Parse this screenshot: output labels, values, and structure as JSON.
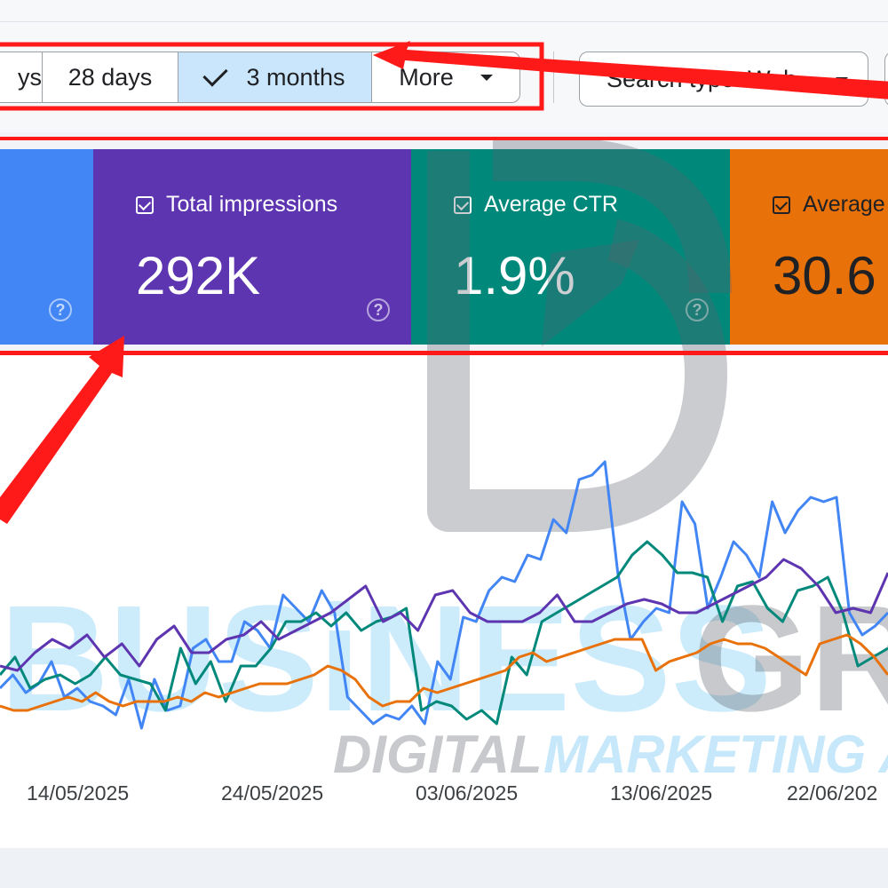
{
  "date_range": {
    "partial_label": "ys",
    "options": [
      {
        "label": "28 days"
      },
      {
        "label": "3 months",
        "selected": true
      },
      {
        "label": "More"
      }
    ]
  },
  "search_type": {
    "label": "Search type: Web"
  },
  "metrics": [
    {
      "label": "",
      "value": "",
      "color": "#4285f4"
    },
    {
      "label": "Total impressions",
      "value": "292K",
      "color": "#5e35b1"
    },
    {
      "label": "Average CTR",
      "value": "1.9%",
      "color": "#00897b"
    },
    {
      "label": "Average",
      "value": "30.6",
      "color": "#e8710a"
    }
  ],
  "watermark": {
    "word1": "BUSiNESS",
    "word2": "GRO",
    "tagline1": "DIGITAL",
    "tagline2": "MARKETING A"
  },
  "chart_data": {
    "type": "line",
    "x_tick_labels": [
      "14/05/2025",
      "24/05/2025",
      "03/06/2025",
      "13/06/2025",
      "22/06/202"
    ],
    "series": [
      {
        "color": "#4285f4",
        "values": [
          775,
          760,
          780,
          770,
          745,
          785,
          775,
          790,
          795,
          805,
          765,
          820,
          765,
          800,
          795,
          730,
          720,
          745,
          745,
          700,
          710,
          730,
          670,
          685,
          700,
          665,
          690,
          785,
          800,
          815,
          805,
          810,
          795,
          815,
          745,
          765,
          695,
          700,
          665,
          650,
          655,
          625,
          630,
          585,
          600,
          540,
          535,
          520,
          645,
          720,
          700,
          685,
          690,
          565,
          590,
          685,
          650,
          610,
          625,
          650,
          565,
          600,
          575,
          560,
          565,
          560,
          690,
          715,
          705,
          690
        ]
      },
      {
        "color": "#00897b",
        "values": [
          760,
          740,
          775,
          765,
          760,
          770,
          760,
          740,
          760,
          765,
          770,
          800,
          730,
          770,
          745,
          790,
          750,
          750,
          730,
          700,
          700,
          690,
          705,
          690,
          710,
          700,
          695,
          685,
          800,
          790,
          795,
          810,
          800,
          815,
          740,
          760,
          700,
          690,
          680,
          670,
          660,
          650,
          625,
          610,
          625,
          645,
          645,
          650,
          700,
          660,
          655,
          685,
          700,
          665,
          660,
          650,
          690,
          750,
          740,
          730
        ]
      },
      {
        "color": "#5e35b1",
        "values": [
          750,
          755,
          735,
          720,
          730,
          715,
          740,
          725,
          750,
          720,
          705,
          735,
          735,
          720,
          715,
          700,
          720,
          710,
          700,
          690,
          675,
          660,
          700,
          690,
          710,
          670,
          665,
          690,
          700,
          700,
          700,
          690,
          670,
          700,
          700,
          690,
          680,
          675,
          680,
          690,
          690,
          680,
          670,
          660,
          650,
          630,
          640,
          660,
          690,
          685,
          690,
          645
        ]
      },
      {
        "color": "#e8710a",
        "values": [
          795,
          800,
          800,
          795,
          790,
          785,
          790,
          780,
          790,
          795,
          790,
          790,
          790,
          785,
          790,
          780,
          785,
          780,
          775,
          770,
          770,
          770,
          765,
          760,
          750,
          755,
          765,
          785,
          795,
          790,
          790,
          775,
          780,
          775,
          770,
          765,
          760,
          755,
          740,
          735,
          745,
          740,
          735,
          730,
          725,
          720,
          720,
          720,
          755,
          745,
          740,
          735,
          725,
          720,
          725,
          725,
          730,
          740,
          750,
          760,
          725,
          720,
          715,
          725,
          740,
          760
        ]
      }
    ]
  }
}
